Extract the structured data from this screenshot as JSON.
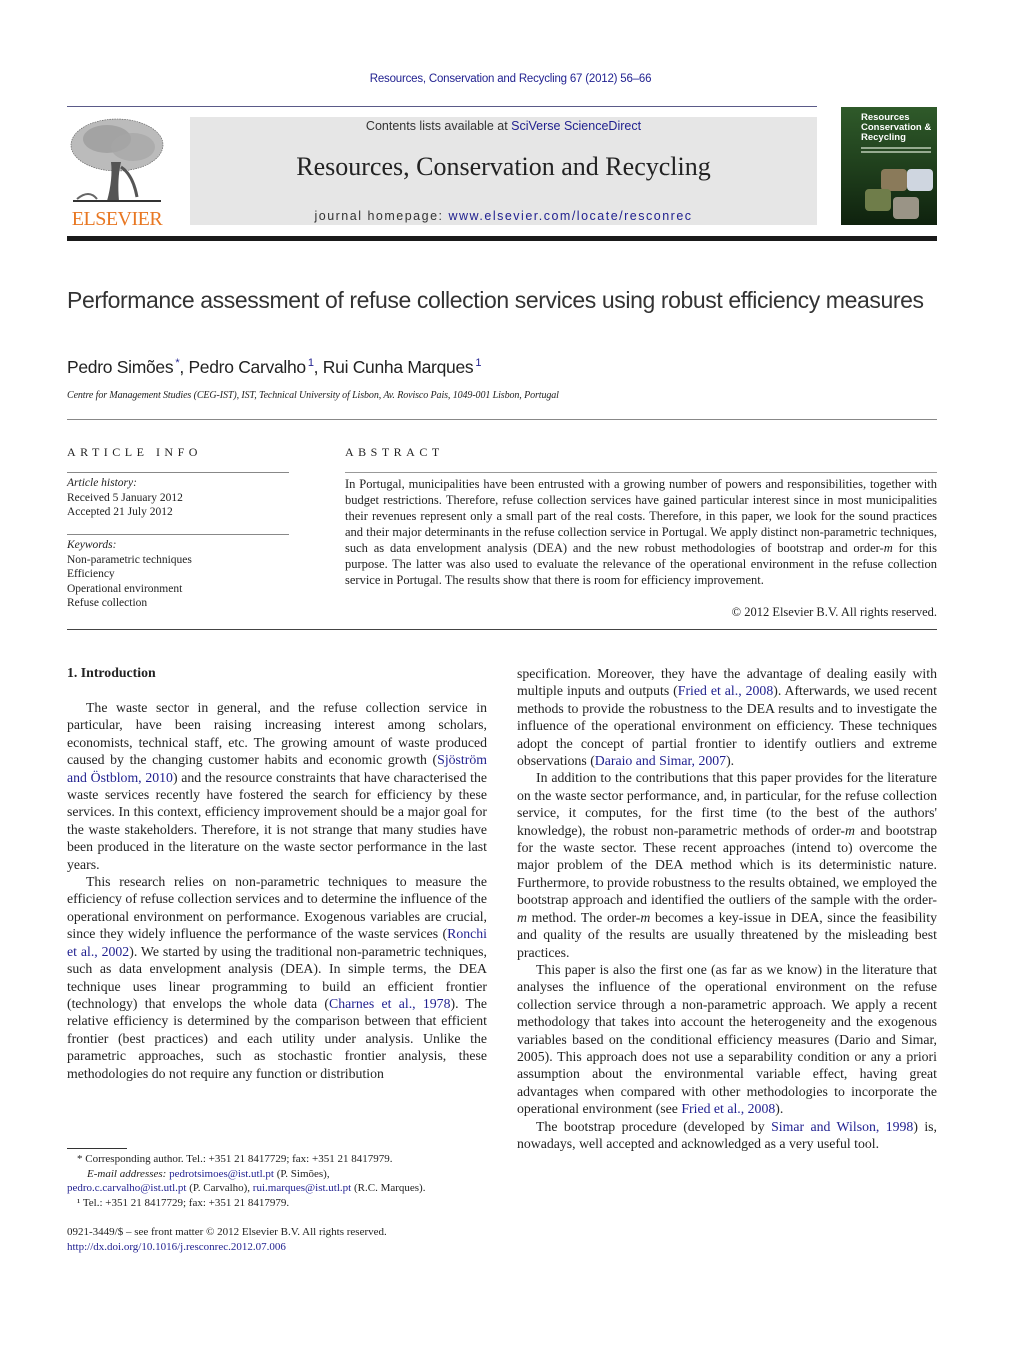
{
  "header": {
    "citation": "Resources, Conservation and Recycling 67 (2012) 56–66",
    "publisher_logo_text": "ELSEVIER",
    "contents_prefix": "Contents lists available at ",
    "contents_link": "SciVerse ScienceDirect",
    "journal_name": "Resources, Conservation and Recycling",
    "homepage_prefix": "journal homepage: ",
    "homepage_link": "www.elsevier.com/locate/resconrec",
    "cover_title_lines": [
      "Resources",
      "Conservation &",
      "Recycling"
    ],
    "colors": {
      "link": "#1f1f8f",
      "elsevier_orange": "#e87722",
      "masthead_bg": "#e6e6e6"
    }
  },
  "article": {
    "title": "Performance assessment of refuse collection services using robust efficiency measures",
    "authors": [
      {
        "name": "Pedro Simões",
        "mark": "*"
      },
      {
        "name": "Pedro Carvalho",
        "mark": "1"
      },
      {
        "name": "Rui Cunha Marques",
        "mark": "1"
      }
    ],
    "affiliation": "Centre for Management Studies (CEG-IST), IST, Technical University of Lisbon, Av. Rovisco Pais, 1049-001 Lisbon, Portugal"
  },
  "article_info": {
    "heading": "ARTICLE INFO",
    "history_label": "Article history:",
    "received": "Received 5 January 2012",
    "accepted": "Accepted 21 July 2012",
    "keywords_label": "Keywords:",
    "keywords": [
      "Non-parametric techniques",
      "Efficiency",
      "Operational environment",
      "Refuse collection"
    ]
  },
  "abstract": {
    "heading": "ABSTRACT",
    "text_before_m": "In Portugal, municipalities have been entrusted with a growing number of powers and responsibilities, together with budget restrictions. Therefore, refuse collection services have gained particular interest since in most municipalities their revenues represent only a small part of the real costs. Therefore, in this paper, we look for the sound practices and their major determinants in the refuse collection service in Portugal. We apply distinct non-parametric techniques, such as data envelopment analysis (DEA) and the new robust methodologies of bootstrap and order-",
    "m": "m",
    "text_after_m": " for this purpose. The latter was also used to evaluate the relevance of the operational environment in the refuse collection service in Portugal. The results show that there is room for efficiency improvement.",
    "copyright": "© 2012 Elsevier B.V. All rights reserved."
  },
  "body": {
    "section_heading": "1.  Introduction",
    "left": {
      "p1_a": "The waste sector in general, and the refuse collection service in particular, have been raising increasing interest among scholars, economists, technical staff, etc. The growing amount of waste produced caused by the changing customer habits and economic growth (",
      "p1_ref": "Sjöström and Östblom, 2010",
      "p1_b": ") and the resource constraints that have characterised the waste services recently have fostered the search for efficiency by these services. In this context, efficiency improvement should be a major goal for the waste stakeholders. Therefore, it is not strange that many studies have been produced in the literature on the waste sector performance in the last years.",
      "p2_a": "This research relies on non-parametric techniques to measure the efficiency of refuse collection services and to determine the influence of the operational environment on performance. Exogenous variables are crucial, since they widely influence the performance of the waste services (",
      "p2_ref1": "Ronchi et al., 2002",
      "p2_b": "). We started by using the traditional non-parametric techniques, such as data envelopment analysis (DEA). In simple terms, the DEA technique uses linear programming to build an efficient frontier (technology) that envelops the whole data (",
      "p2_ref2": "Charnes et al., 1978",
      "p2_c": "). The relative efficiency is determined by the comparison between that efficient frontier (best practices) and each utility under analysis. Unlike the parametric approaches, such as stochastic frontier analysis, these methodologies do not require any function or distribution"
    },
    "right": {
      "p1_a": "specification. Moreover, they have the advantage of dealing easily with multiple inputs and outputs (",
      "p1_ref1": "Fried et al., 2008",
      "p1_b": "). Afterwards, we used recent methods to provide the robustness to the DEA results and to investigate the influence of the operational environment on efficiency. These techniques adopt the concept of partial frontier to identify outliers and extreme observations (",
      "p1_ref2": "Daraio and Simar, 2007",
      "p1_c": ").",
      "p2_a": "In addition to the contributions that this paper provides for the literature on the waste sector performance, and, in particular, for the refuse collection service, it computes, for the first time (to the best of the authors' knowledge), the robust non-parametric methods of order-",
      "p2_m1": "m",
      "p2_b": " and bootstrap for the waste sector. These recent approaches (intend to) overcome the major problem of the DEA method which is its deterministic nature. Furthermore, to provide robustness to the results obtained, we employed the bootstrap approach and identified the outliers of the sample with the order-",
      "p2_m2": "m",
      "p2_c": " method. The order-",
      "p2_m3": "m",
      "p2_d": " becomes a key-issue in DEA, since the feasibility and quality of the results are usually threatened by the misleading best practices.",
      "p3_a": "This paper is also the first one (as far as we know) in the literature that analyses the influence of the operational environment on the refuse collection service through a non-parametric approach. We apply a recent methodology that takes into account the heterogeneity and the exogenous variables based on the conditional efficiency measures (Dario and Simar, 2005). This approach does not use a separability condition or any a priori assumption about the environmental variable effect, having great advantages when compared with other methodologies to incorporate the operational environment (see ",
      "p3_ref": "Fried et al., 2008",
      "p3_b": ").",
      "p4_a": "The bootstrap procedure (developed by ",
      "p4_ref": "Simar and Wilson, 1998",
      "p4_b": ") is, nowadays, well accepted and acknowledged as a very useful tool."
    }
  },
  "footnotes": {
    "corresponding": "* Corresponding author. Tel.: +351 21 8417729; fax: +351 21 8417979.",
    "email_label": "E-mail addresses:",
    "email1": "pedrotsimoes@ist.utl.pt",
    "email1_who": " (P. Simões),",
    "email2": "pedro.c.carvalho@ist.utl.pt",
    "email2_who": " (P. Carvalho), ",
    "email3": "rui.marques@ist.utl.pt",
    "email3_who": " (R.C. Marques).",
    "fn1": "¹  Tel.: +351 21 8417729; fax: +351 21 8417979.",
    "front_matter": "0921-3449/$ – see front matter © 2012 Elsevier B.V. All rights reserved.",
    "doi": "http://dx.doi.org/10.1016/j.resconrec.2012.07.006"
  }
}
